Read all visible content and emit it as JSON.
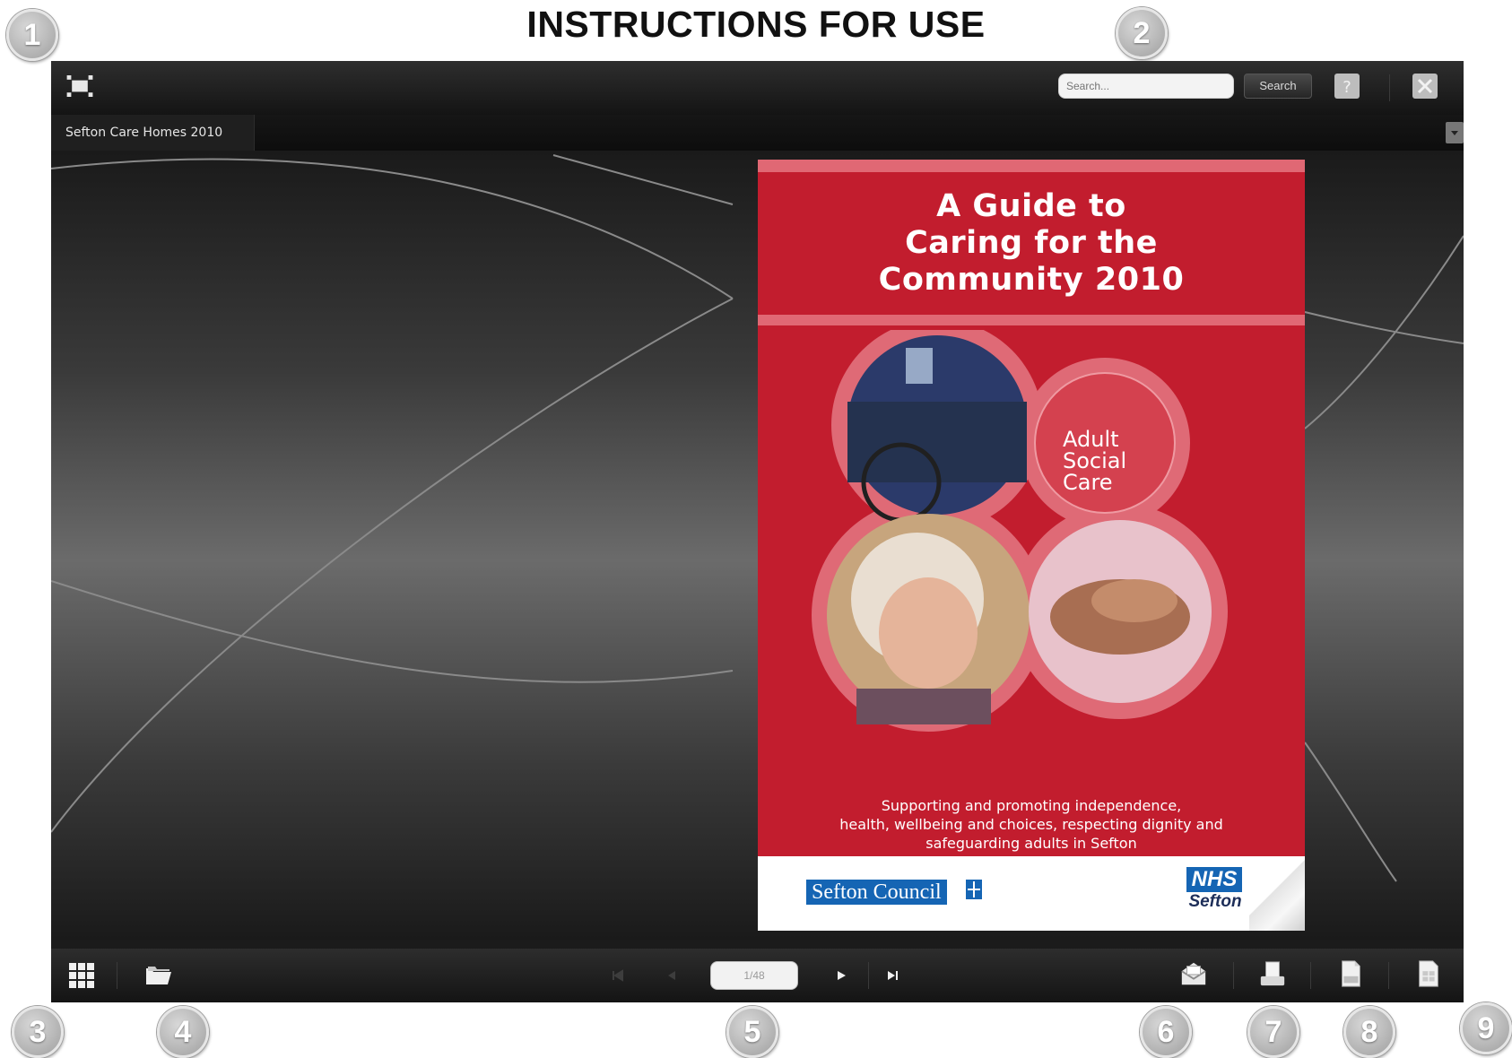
{
  "heading": "INSTRUCTIONS FOR USE",
  "callouts": [
    "1",
    "2",
    "3",
    "4",
    "5",
    "5",
    "6",
    "7",
    "8",
    "9"
  ],
  "toolbar": {
    "search_placeholder": "Search...",
    "search_button": "Search",
    "icons": [
      "fullscreen-icon",
      "help-icon",
      "close-icon"
    ]
  },
  "tabs": {
    "title": "Sefton Care Homes 2010"
  },
  "bottom_toolbar": {
    "page_indicator": "1/48",
    "icons": [
      "grid-thumbnails-icon",
      "folder-icon",
      "first-page-icon",
      "previous-page-icon",
      "play-icon",
      "last-page-icon",
      "email-icon",
      "print-icon",
      "pdf-icon",
      "download-page-icon"
    ]
  },
  "cover": {
    "title_lines": [
      "A Guide to",
      "Caring for the",
      "Community 2010"
    ],
    "badge_lines": [
      "Adult",
      "Social",
      "Care"
    ],
    "tagline_lines": [
      "Supporting and promoting independence,",
      "health, wellbeing and choices, respecting dignity and",
      "safeguarding adults in Sefton"
    ],
    "logo_left": "Sefton Council",
    "logo_right_top": "NHS",
    "logo_right_bottom": "Sefton"
  },
  "colors": {
    "cover_red": "#c21d2e",
    "cover_pink": "#e06874",
    "nhs_blue": "#1565b4",
    "toolbar_dark": "#1b1b1b"
  }
}
